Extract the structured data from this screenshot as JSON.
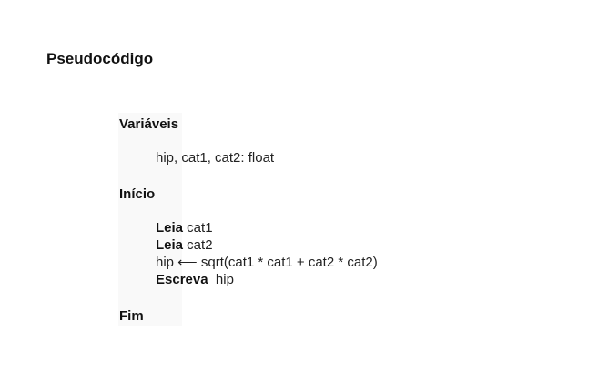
{
  "title": "Pseudocódigo",
  "sections": {
    "variables_label": "Variáveis",
    "variables_decl": "hip, cat1, cat2: float",
    "start_label": "Início",
    "statements": [
      {
        "keyword": "Leia",
        "rest": " cat1"
      },
      {
        "keyword": "Leia",
        "rest": " cat2"
      },
      {
        "keyword": "",
        "rest": "hip ⟵ sqrt(cat1 * cat1 + cat2 * cat2)"
      },
      {
        "keyword": "Escreva",
        "rest": "  hip"
      }
    ],
    "end_label": "Fim"
  }
}
